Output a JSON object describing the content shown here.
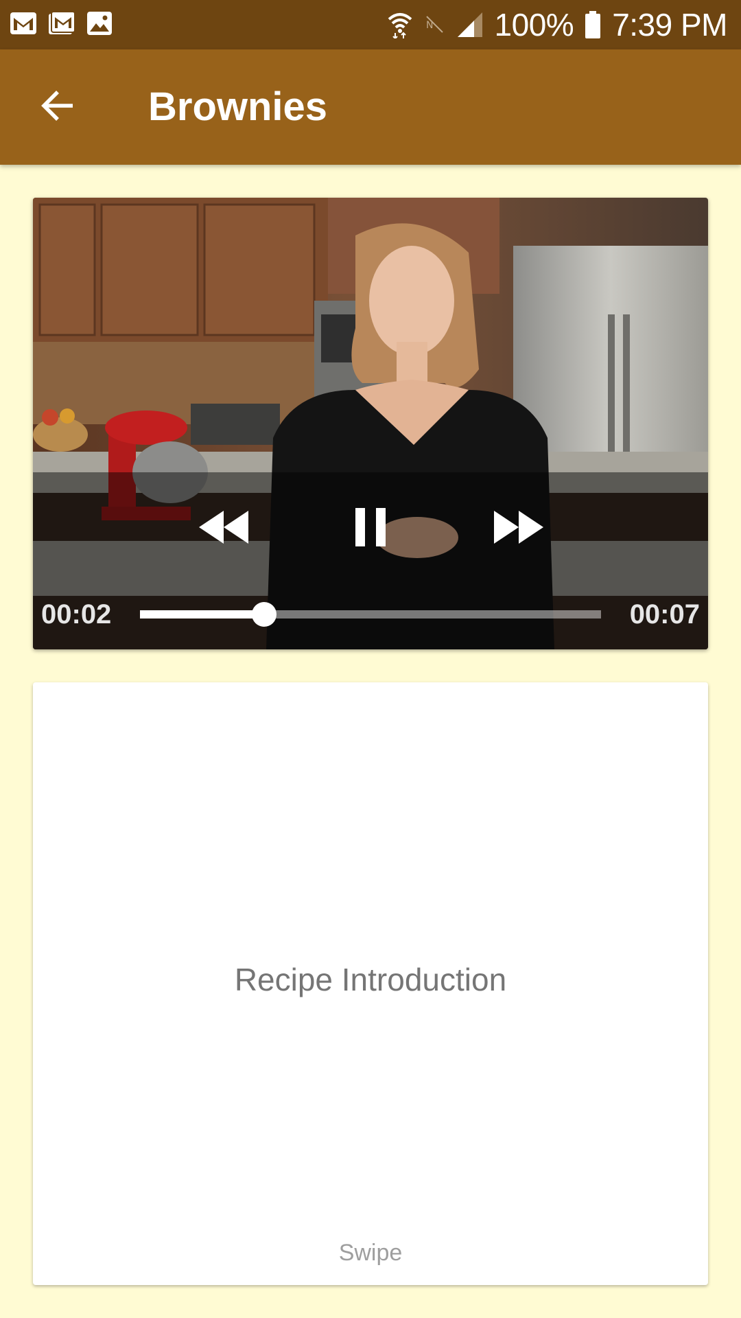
{
  "status_bar": {
    "left_icons": [
      "gmail-icon",
      "gmail-inbox-icon",
      "gallery-icon"
    ],
    "right_icons": [
      "wifi-icon",
      "nfc-off-icon",
      "cell-signal-icon",
      "battery-icon"
    ],
    "battery_percent": "100%",
    "time": "7:39 PM"
  },
  "app_bar": {
    "back_icon": "arrow-back-icon",
    "title": "Brownies"
  },
  "video_player": {
    "state": "playing",
    "current_time": "00:02",
    "total_time": "00:07",
    "progress": 0.27,
    "controls": [
      "rewind-icon",
      "pause-icon",
      "fast-forward-icon"
    ]
  },
  "step_card": {
    "title": "Recipe Introduction",
    "hint": "Swipe"
  },
  "colors": {
    "status_bar": "#6e4511",
    "app_bar": "#98621a",
    "background": "#fffbd3",
    "card": "#ffffff",
    "step_text": "#757575",
    "hint_text": "#9e9e9e"
  }
}
